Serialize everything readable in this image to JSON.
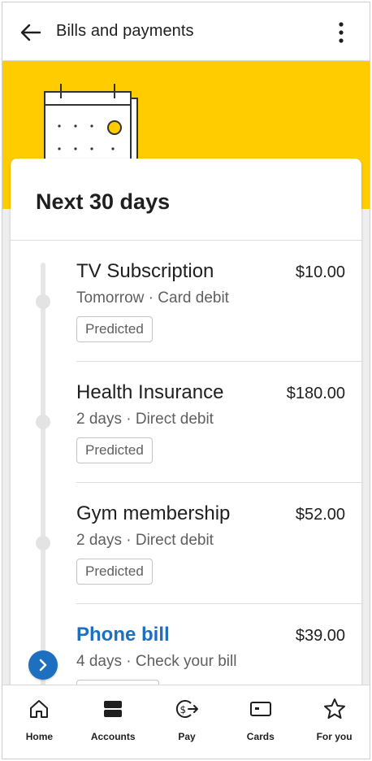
{
  "header": {
    "title": "Bills and payments"
  },
  "colors": {
    "hero": "#ffcc00",
    "link": "#1e6fbf",
    "text": "#1f1f1f",
    "secondary_text": "#5f5f5f"
  },
  "card": {
    "title": "Next 30 days"
  },
  "bills": [
    {
      "name": "TV Subscription",
      "amount": "$10.00",
      "meta": "Tomorrow · Card debit",
      "tag": "Predicted"
    },
    {
      "name": "Health Insurance",
      "amount": "$180.00",
      "meta": "2 days · Direct debit",
      "tag": "Predicted"
    },
    {
      "name": "Gym membership",
      "amount": "$52.00",
      "meta": "2 days · Direct debit",
      "tag": "Predicted"
    },
    {
      "name": "Phone bill",
      "amount": "$39.00",
      "meta": "4 days · Check your bill",
      "tag": ""
    }
  ],
  "nav": [
    {
      "label": "Home",
      "icon": "home-icon"
    },
    {
      "label": "Accounts",
      "icon": "accounts-icon"
    },
    {
      "label": "Pay",
      "icon": "pay-icon"
    },
    {
      "label": "Cards",
      "icon": "cards-icon"
    },
    {
      "label": "For you",
      "icon": "star-icon"
    }
  ]
}
